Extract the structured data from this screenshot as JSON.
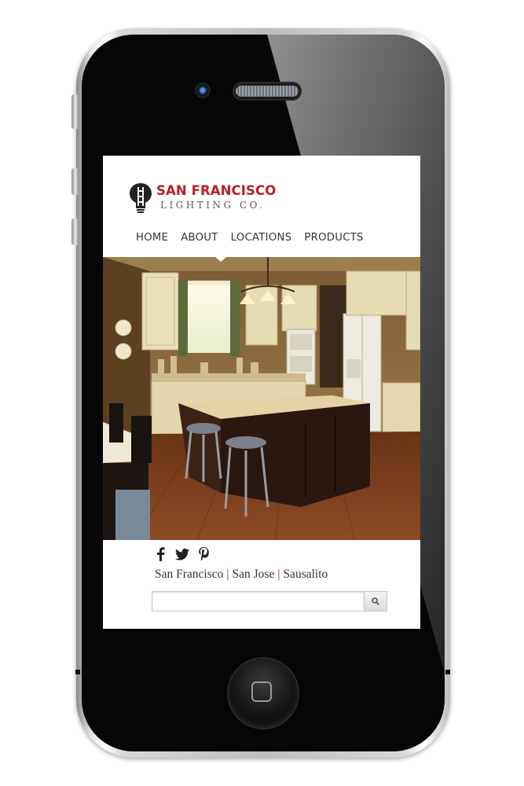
{
  "brand": {
    "name_line1": "SAN FRANCISCO",
    "name_line2": "LIGHTING CO.",
    "accent_color": "#b72027"
  },
  "nav": {
    "items": [
      "HOME",
      "ABOUT",
      "LOCATIONS",
      "PRODUCTS"
    ],
    "active_index": 1
  },
  "hero": {
    "subject": "kitchen interior photo with island, bar stools and pendant light"
  },
  "social": {
    "icons": [
      "facebook-icon",
      "twitter-icon",
      "pinterest-icon"
    ]
  },
  "locations": {
    "items": [
      "San Francisco",
      "San Jose",
      "Sausalito"
    ],
    "separator": "|"
  },
  "search": {
    "value": "",
    "placeholder": "",
    "button_icon": "search-icon"
  }
}
